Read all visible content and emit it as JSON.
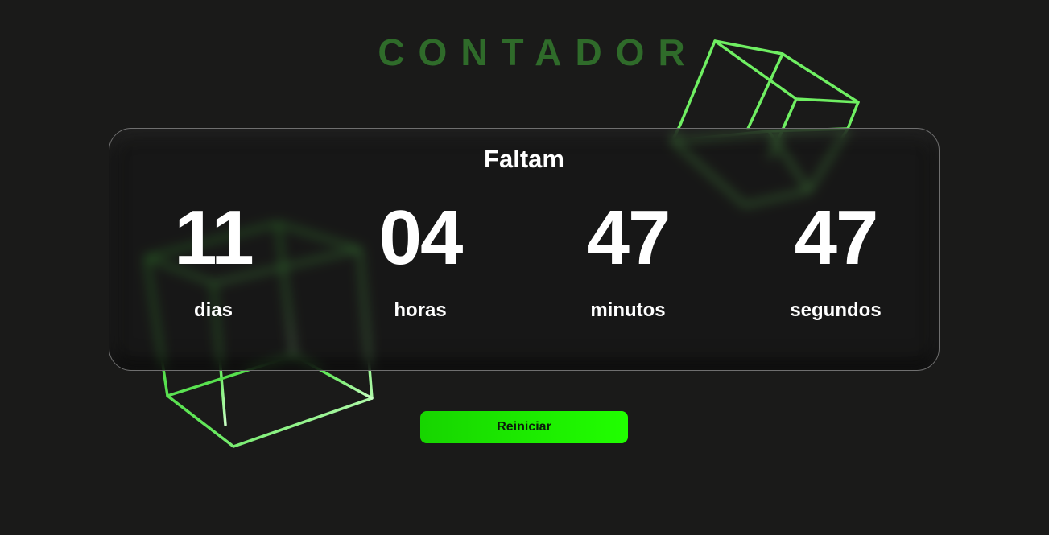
{
  "title": "CONTADOR",
  "panel": {
    "heading": "Faltam",
    "units": [
      {
        "value": "11",
        "label": "dias"
      },
      {
        "value": "04",
        "label": "horas"
      },
      {
        "value": "47",
        "label": "minutos"
      },
      {
        "value": "47",
        "label": "segundos"
      }
    ]
  },
  "button": {
    "label": "Reiniciar"
  },
  "colors": {
    "background": "#1a1a19",
    "title": "#2f6b2a",
    "accent": "#21ff00",
    "cube_stroke": "#6fef62"
  }
}
